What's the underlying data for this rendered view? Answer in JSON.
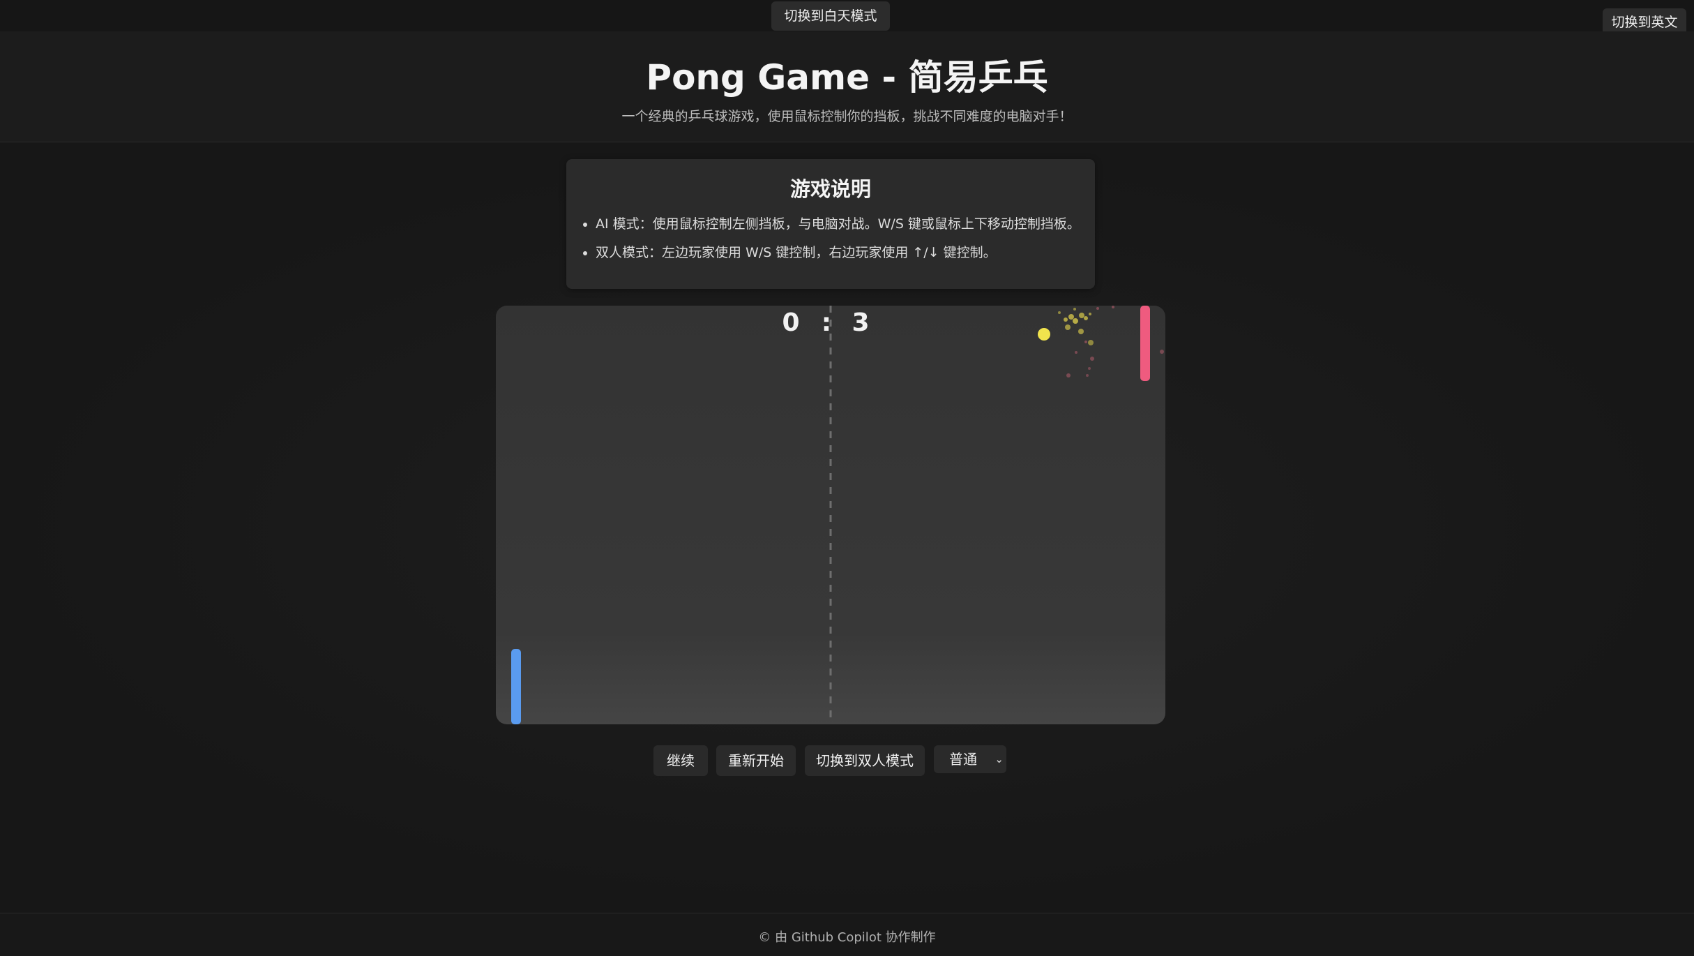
{
  "topbar": {
    "theme_button": "切换到白天模式",
    "lang_button": "切换到英文"
  },
  "header": {
    "title": "Pong Game - 简易乒乓",
    "subtitle": "一个经典的乒乓球游戏，使用鼠标控制你的挡板，挑战不同难度的电脑对手！"
  },
  "instructions": {
    "heading": "游戏说明",
    "items": [
      "AI 模式：使用鼠标控制左侧挡板，与电脑对战。W/S 键或鼠标上下移动控制挡板。",
      "双人模式：左边玩家使用 W/S 键控制，右边玩家使用 ↑/↓ 键控制。"
    ]
  },
  "game": {
    "score_left": "0",
    "score_separator": ":",
    "score_right": "3",
    "left_paddle_color": "#5a9bef",
    "right_paddle_color": "#ef5b7f",
    "ball_color": "#f1e44d"
  },
  "controls": {
    "continue_label": "继续",
    "restart_label": "重新开始",
    "mode_label": "切换到双人模式",
    "difficulty_selected": "普通"
  },
  "footer": {
    "text": "© 由 Github Copilot 协作制作"
  }
}
